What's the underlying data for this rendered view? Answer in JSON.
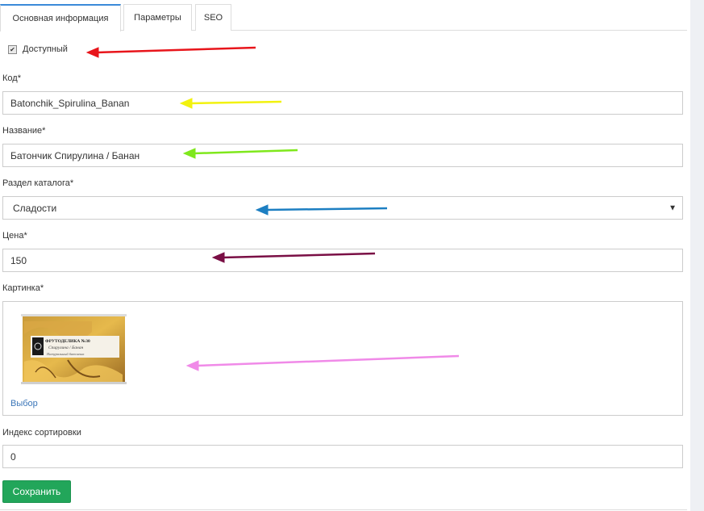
{
  "tabs": [
    {
      "label": "Основная информация",
      "active": true
    },
    {
      "label": "Параметры",
      "active": false
    },
    {
      "label": "SEO",
      "active": false
    }
  ],
  "available": {
    "label": "Доступный",
    "checked": true
  },
  "code": {
    "label": "Код*",
    "value": "Batonchik_Spirulina_Banan"
  },
  "name": {
    "label": "Название*",
    "value": "Батончик Спирулина / Банан"
  },
  "catalog_section": {
    "label": "Раздел каталога*",
    "value": "Сладости"
  },
  "price": {
    "label": "Цена*",
    "value": "150"
  },
  "picture": {
    "label": "Картинка*",
    "choose_link": "Выбор",
    "package_brand": "ФРУТОДЕЛИКА №30",
    "package_flavor": "Спирулина / Банан",
    "package_subtitle": "Натуральный батончик"
  },
  "sort_index": {
    "label": "Индекс сортировки",
    "value": "0"
  },
  "save_button": "Сохранить",
  "colors": {
    "accent_tab": "#3b8ad9",
    "save_button": "#22a65a",
    "link": "#3b76b8",
    "arrow_red": "#e8151b",
    "arrow_yellow": "#f2f20f",
    "arrow_green": "#7fe81c",
    "arrow_blue": "#1d7fc2",
    "arrow_maroon": "#7a0f45",
    "arrow_pink": "#f08ae8"
  }
}
